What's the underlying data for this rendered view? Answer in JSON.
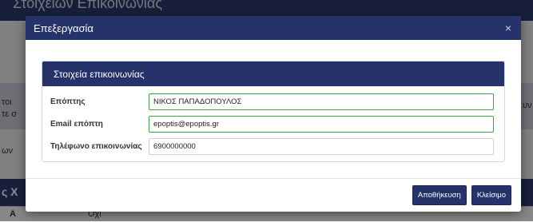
{
  "background": {
    "header_title": "Στοιχείων Επικοινωνίας",
    "frag_left_1": "τοι",
    "frag_left_2": "τε σ",
    "frag_right": "υν",
    "frag_left_3": "ων",
    "frag_left_4": "ς Χ",
    "frag_bottom_a": "Α",
    "frag_bottom_b": "Όχι"
  },
  "modal": {
    "title": "Επεξεργασία",
    "close_icon": "×",
    "panel_title": "Στοιχεία επικοινωνίας",
    "fields": [
      {
        "label": "Επόπτης",
        "value": "ΝΙΚΟΣ ΠΑΠΑΔΟΠΟΥΛΟΣ"
      },
      {
        "label": "Email επόπτη",
        "value": "epoptis@epoptis.gr"
      },
      {
        "label": "Τηλέφωνο επικοινωνίας",
        "value": "6900000000"
      }
    ],
    "save_label": "Αποθήκευση",
    "close_label": "Κλείσιμο"
  },
  "colors": {
    "header": "#25336a",
    "valid_border": "#3aa54a"
  }
}
